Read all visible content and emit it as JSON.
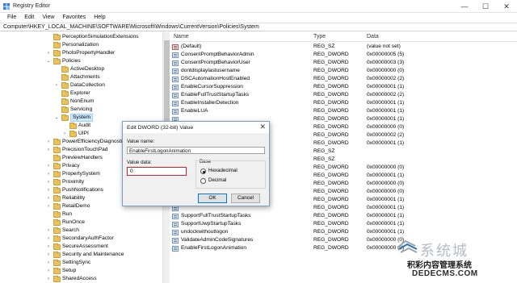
{
  "window": {
    "title": "Registry Editor",
    "controls": {
      "minimize": "—",
      "maximize": "☐",
      "close": "✕"
    }
  },
  "menu": [
    "File",
    "Edit",
    "View",
    "Favorites",
    "Help"
  ],
  "address": "Computer\\HKEY_LOCAL_MACHINE\\SOFTWARE\\Microsoft\\Windows\\CurrentVersion\\Policies\\System",
  "tree": [
    {
      "label": "PerceptionSimulationExtensions",
      "level": 0,
      "chev": ""
    },
    {
      "label": "Personalization",
      "level": 0,
      "chev": ""
    },
    {
      "label": "PhotoPropertyHandler",
      "level": 0,
      "chev": "›"
    },
    {
      "label": "Policies",
      "level": 0,
      "chev": "⌄"
    },
    {
      "label": "ActiveDesktop",
      "level": 1,
      "chev": ""
    },
    {
      "label": "Attachments",
      "level": 1,
      "chev": ""
    },
    {
      "label": "DataCollection",
      "level": 1,
      "chev": "›"
    },
    {
      "label": "Explorer",
      "level": 1,
      "chev": ""
    },
    {
      "label": "NonEnum",
      "level": 1,
      "chev": ""
    },
    {
      "label": "Servicing",
      "level": 1,
      "chev": ""
    },
    {
      "label": "System",
      "level": 1,
      "chev": "⌄",
      "selected": true
    },
    {
      "label": "Audit",
      "level": 2,
      "chev": ""
    },
    {
      "label": "UIPI",
      "level": 2,
      "chev": "›"
    },
    {
      "label": "PowerEfficiencyDiagnostic",
      "level": 0,
      "chev": "›"
    },
    {
      "label": "PrecisionTouchPad",
      "level": 0,
      "chev": "›"
    },
    {
      "label": "PreviewHandlers",
      "level": 0,
      "chev": ""
    },
    {
      "label": "Privacy",
      "level": 0,
      "chev": "›"
    },
    {
      "label": "PropertySystem",
      "level": 0,
      "chev": "›"
    },
    {
      "label": "Proximity",
      "level": 0,
      "chev": "›"
    },
    {
      "label": "PushNotifications",
      "level": 0,
      "chev": "›"
    },
    {
      "label": "Reliability",
      "level": 0,
      "chev": "›"
    },
    {
      "label": "RetailDemo",
      "level": 0,
      "chev": "›"
    },
    {
      "label": "Run",
      "level": 0,
      "chev": ""
    },
    {
      "label": "RunOnce",
      "level": 0,
      "chev": ""
    },
    {
      "label": "Search",
      "level": 0,
      "chev": "›"
    },
    {
      "label": "SecondaryAuthFactor",
      "level": 0,
      "chev": "›"
    },
    {
      "label": "SecureAssessment",
      "level": 0,
      "chev": "›"
    },
    {
      "label": "Security and Maintenance",
      "level": 0,
      "chev": "›"
    },
    {
      "label": "SettingSync",
      "level": 0,
      "chev": "›"
    },
    {
      "label": "Setup",
      "level": 0,
      "chev": "›"
    },
    {
      "label": "SharedAccess",
      "level": 0,
      "chev": "›"
    }
  ],
  "list": {
    "headers": {
      "name": "Name",
      "type": "Type",
      "data": "Data"
    },
    "rows": [
      {
        "name": "(Default)",
        "type": "REG_SZ",
        "data": "(value not set)",
        "kind": "sz"
      },
      {
        "name": "ConsentPromptBehaviorAdmin",
        "type": "REG_DWORD",
        "data": "0x00000005 (5)",
        "kind": "dw"
      },
      {
        "name": "ConsentPromptBehaviorUser",
        "type": "REG_DWORD",
        "data": "0x00000003 (3)",
        "kind": "dw"
      },
      {
        "name": "dontdisplaylastusername",
        "type": "REG_DWORD",
        "data": "0x00000000 (0)",
        "kind": "dw"
      },
      {
        "name": "DSCAutomationHostEnabled",
        "type": "REG_DWORD",
        "data": "0x00000002 (2)",
        "kind": "dw"
      },
      {
        "name": "EnableCursorSuppression",
        "type": "REG_DWORD",
        "data": "0x00000001 (1)",
        "kind": "dw"
      },
      {
        "name": "EnableFullTrustStartupTasks",
        "type": "REG_DWORD",
        "data": "0x00000002 (2)",
        "kind": "dw"
      },
      {
        "name": "EnableInstallerDetection",
        "type": "REG_DWORD",
        "data": "0x00000001 (1)",
        "kind": "dw"
      },
      {
        "name": "EnableLUA",
        "type": "REG_DWORD",
        "data": "0x00000001 (1)",
        "kind": "dw"
      },
      {
        "name": "",
        "type": "REG_DWORD",
        "data": "0x00000001 (1)",
        "kind": "dw"
      },
      {
        "name": "",
        "type": "REG_DWORD",
        "data": "0x00000000 (0)",
        "kind": "dw"
      },
      {
        "name": "",
        "type": "REG_DWORD",
        "data": "0x00000002 (2)",
        "kind": "dw"
      },
      {
        "name": "",
        "type": "REG_DWORD",
        "data": "0x00000001 (1)",
        "kind": "dw"
      },
      {
        "name": "",
        "type": "REG_SZ",
        "data": "",
        "kind": "sz"
      },
      {
        "name": "",
        "type": "REG_SZ",
        "data": "",
        "kind": "sz"
      },
      {
        "name": "",
        "type": "REG_DWORD",
        "data": "0x00000000 (0)",
        "kind": "dw"
      },
      {
        "name": "",
        "type": "REG_DWORD",
        "data": "0x00000001 (1)",
        "kind": "dw"
      },
      {
        "name": "",
        "type": "REG_DWORD",
        "data": "0x00000000 (0)",
        "kind": "dw"
      },
      {
        "name": "",
        "type": "REG_DWORD",
        "data": "0x00000000 (0)",
        "kind": "dw"
      },
      {
        "name": "",
        "type": "REG_DWORD",
        "data": "0x00000001 (1)",
        "kind": "dw"
      },
      {
        "name": "",
        "type": "REG_DWORD",
        "data": "0x00000001 (1)",
        "kind": "dw"
      },
      {
        "name": "SupportFullTrustStartupTasks",
        "type": "REG_DWORD",
        "data": "0x00000001 (1)",
        "kind": "dw"
      },
      {
        "name": "SupportUwpStartupTasks",
        "type": "REG_DWORD",
        "data": "0x00000001 (1)",
        "kind": "dw"
      },
      {
        "name": "undockwithoutlogon",
        "type": "REG_DWORD",
        "data": "0x00000001 (1)",
        "kind": "dw"
      },
      {
        "name": "ValidateAdminCodeSignatures",
        "type": "REG_DWORD",
        "data": "0x00000000 (0)",
        "kind": "dw"
      },
      {
        "name": "EnableFirstLogonAnimation",
        "type": "REG_DWORD",
        "data": "0x00000000 (0)",
        "kind": "dw"
      }
    ]
  },
  "dialog": {
    "title": "Edit DWORD (32-bit) Value",
    "close": "✕",
    "value_name_label": "Value name:",
    "value_name": "EnableFirstLogonAnimation",
    "value_data_label": "Value data:",
    "value_data": "0",
    "base_label": "Base",
    "hex_label": "Hexadecimal",
    "dec_label": "Decimal",
    "base_selected": "Hexadecimal",
    "ok_label": "OK",
    "cancel_label": "Cancel"
  },
  "watermark": {
    "big": "系统城",
    "mid": "积彩内容管理系统",
    "url": "DEDECMS.COM"
  }
}
